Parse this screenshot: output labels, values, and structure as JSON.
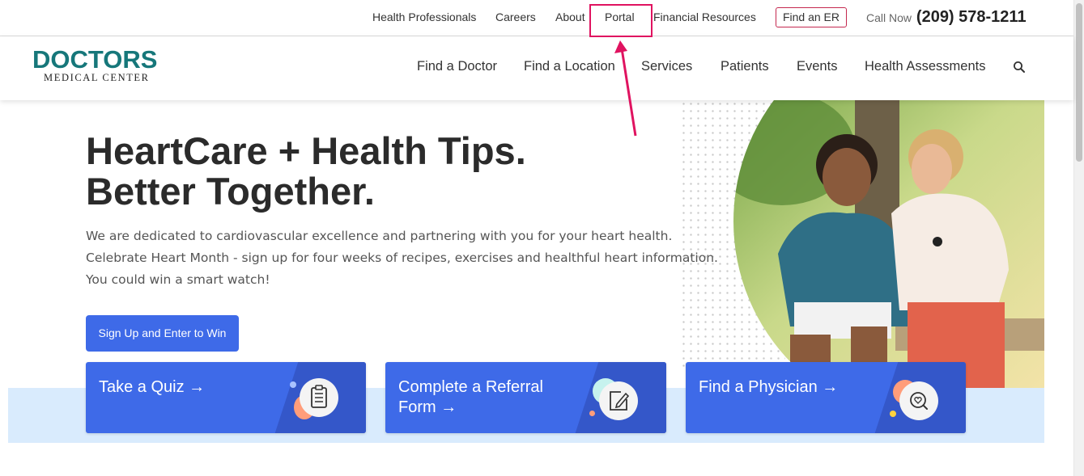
{
  "topbar": {
    "links": [
      "Health Professionals",
      "Careers",
      "About",
      "Portal",
      "Financial Resources"
    ],
    "find_er": "Find an ER",
    "call_label": "Call Now",
    "phone": "(209) 578-1211"
  },
  "header": {
    "logo_main": "DOCTORS",
    "logo_sub": "MEDICAL CENTER",
    "nav": [
      "Find a Doctor",
      "Find a Location",
      "Services",
      "Patients",
      "Events",
      "Health Assessments"
    ],
    "search_icon": "search-icon"
  },
  "hero": {
    "title_line1": "HeartCare + Health Tips.",
    "title_line2": "Better Together.",
    "text_line1": "We are dedicated to cardiovascular excellence and partnering with you for your heart health.",
    "text_line2": "Celebrate Heart Month - sign up for four weeks of recipes, exercises and healthful heart information.",
    "text_line3": "You could win a smart watch!",
    "cta": "Sign Up and Enter to Win"
  },
  "cards": [
    {
      "label": "Take a Quiz →",
      "icon": "clipboard-icon"
    },
    {
      "label_line1": "Complete a Referral",
      "label_line2": "Form →",
      "icon": "edit-form-icon"
    },
    {
      "label": "Find a Physician →",
      "icon": "heart-search-icon"
    }
  ],
  "colors": {
    "brand_teal": "#16777a",
    "accent_blue": "#3e6ae8",
    "band_blue": "#d9ebfd",
    "annotation": "#e01360"
  }
}
